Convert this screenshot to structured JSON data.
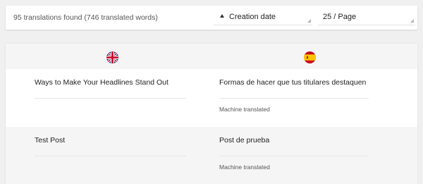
{
  "toolbar": {
    "count_text": "95 translations found (746 translated words)",
    "sort_label": "Creation date",
    "per_page_label": "25 / Page"
  },
  "languages": {
    "source_flag_icon": "uk-flag-icon",
    "target_flag_icon": "spain-flag-icon"
  },
  "rows": [
    {
      "source_title": "Ways to Make Your Headlines Stand Out",
      "target_title": "Formas de hacer que tus titulares destaquen",
      "status": "Machine translated"
    },
    {
      "source_title": "Test Post",
      "target_title": "Post de prueba",
      "status": "Machine translated"
    }
  ]
}
